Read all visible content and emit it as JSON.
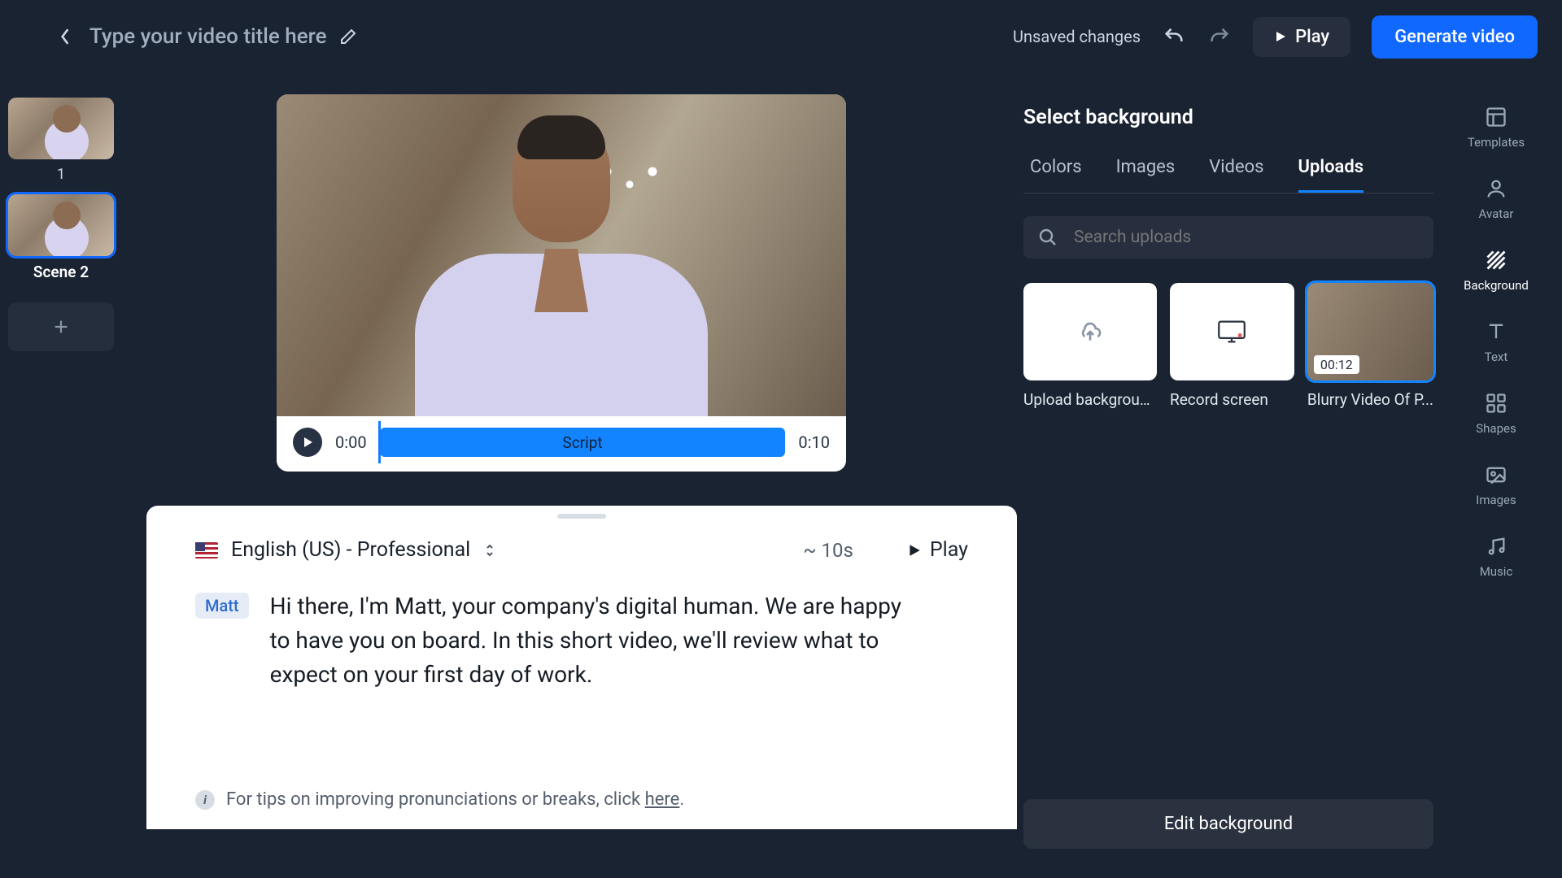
{
  "header": {
    "title_placeholder": "Type your video title here",
    "unsaved": "Unsaved changes",
    "play_label": "Play",
    "generate_label": "Generate video"
  },
  "scenes": {
    "first_num": "1",
    "second_label": "Scene 2"
  },
  "timeline": {
    "start": "0:00",
    "end": "0:10",
    "bar_label": "Script"
  },
  "script": {
    "voice": "English (US) - Professional",
    "duration": "~ 10s",
    "play": "Play",
    "speaker": "Matt",
    "text": "Hi there, I'm Matt, your company's digital human.  We are happy to have you on board. In this short video, we'll review what to expect on your first day of work.",
    "tip_prefix": "For tips on improving pronunciations or breaks, click ",
    "tip_link": "here"
  },
  "right": {
    "title": "Select background",
    "tabs": {
      "colors": "Colors",
      "images": "Images",
      "videos": "Videos",
      "uploads": "Uploads"
    },
    "search_placeholder": "Search uploads",
    "cards": {
      "upload": "Upload background",
      "record": "Record screen",
      "video_name": "Blurry Video Of P...",
      "video_dur": "00:12"
    },
    "edit_label": "Edit background"
  },
  "rail": {
    "templates": "Templates",
    "avatar": "Avatar",
    "background": "Background",
    "text": "Text",
    "shapes": "Shapes",
    "images": "Images",
    "music": "Music"
  }
}
